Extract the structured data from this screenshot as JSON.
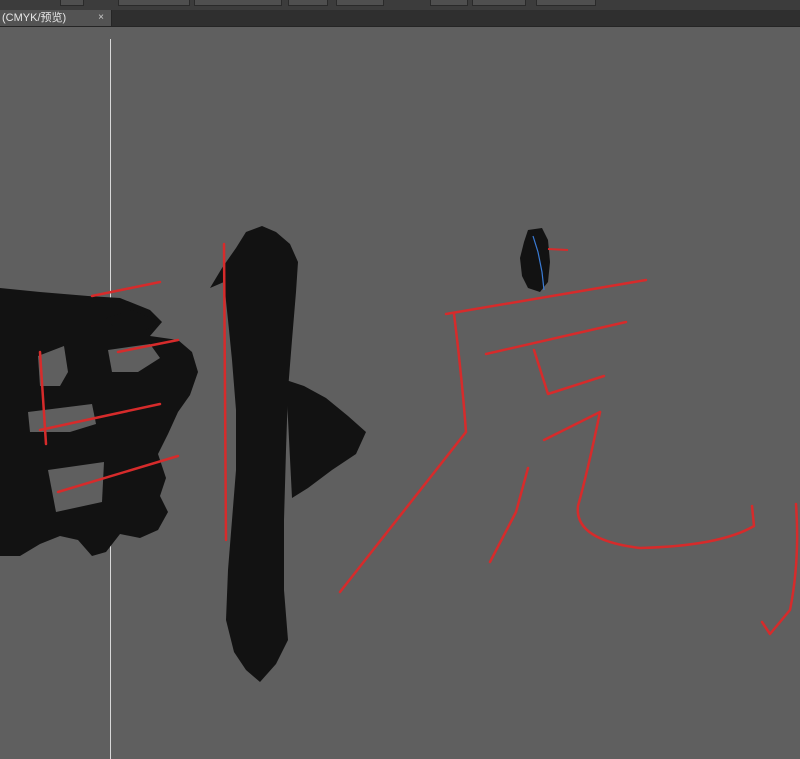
{
  "document": {
    "tab_label": "(CMYK/预览)",
    "close_glyph": "×"
  },
  "icons": {
    "close": "close-icon"
  },
  "colors": {
    "canvas_background": "#5f5f5f",
    "ink": "#121212",
    "path_outline": "#d62b2b",
    "selection_path": "#3a7bd5",
    "artboard_edge": "#d8d8d8"
  },
  "artwork": {
    "brush_character": "卧",
    "outlined_character": "虎"
  }
}
